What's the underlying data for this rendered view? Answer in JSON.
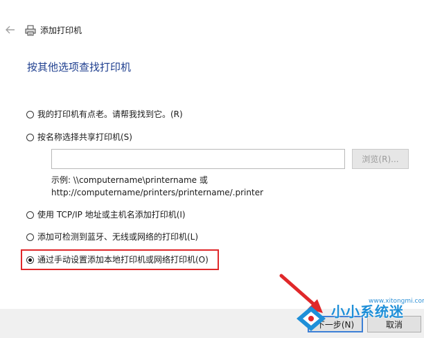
{
  "window": {
    "title": "添加打印机",
    "heading": "按其他选项查找打印机"
  },
  "options": [
    {
      "label": "我的打印机有点老。请帮我找到它。(R)",
      "selected": false
    },
    {
      "label": "按名称选择共享打印机(S)",
      "selected": false
    },
    {
      "label": "使用 TCP/IP 地址或主机名添加打印机(I)",
      "selected": false
    },
    {
      "label": "添加可检测到蓝牙、无线或网络的打印机(L)",
      "selected": false
    },
    {
      "label": "通过手动设置添加本地打印机或网络打印机(O)",
      "selected": true
    }
  ],
  "shared_printer": {
    "input_value": "",
    "browse_label": "浏览(R)...",
    "example_line1": "示例: \\\\computername\\printername 或",
    "example_line2": "http://computername/printers/printername/.printer"
  },
  "buttons": {
    "next_label": "下一步(N)",
    "cancel_label": "取消"
  },
  "watermark": {
    "text": "小小系统迷",
    "url": "www.xitongmi.com"
  },
  "colors": {
    "heading": "#1f3f8f",
    "highlight_border": "#e0282a",
    "arrow": "#e0282a",
    "watermark": "#1e8fd8",
    "focus_border": "#3c7fd6"
  }
}
